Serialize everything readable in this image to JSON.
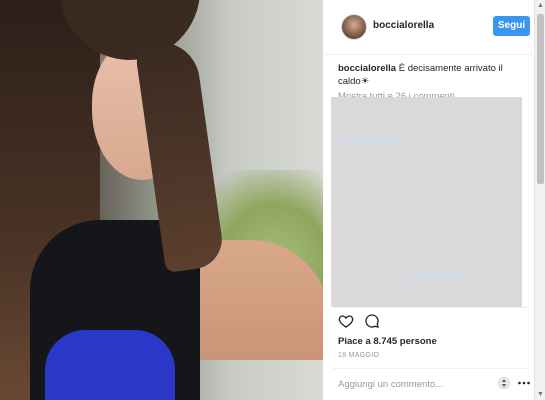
{
  "post": {
    "username": "boccialorella",
    "follow_label": "Segui",
    "caption_user": "boccialorella",
    "caption_text": "È decisamente arrivato il caldo☀",
    "show_all_comments": "Mostra tutti e 26 i commenti",
    "likes": "Piace a 8.745 persone",
    "date": "18 MAGGIO",
    "comment_placeholder": "Aggiungi un commento...",
    "icons": {
      "like": "heart-icon",
      "comment": "comment-bubble-icon",
      "options": "more-options-icon",
      "sort": "up-down-arrows-icon"
    }
  },
  "colors": {
    "accent": "#3897f0",
    "text": "#262626",
    "muted": "#999999"
  }
}
